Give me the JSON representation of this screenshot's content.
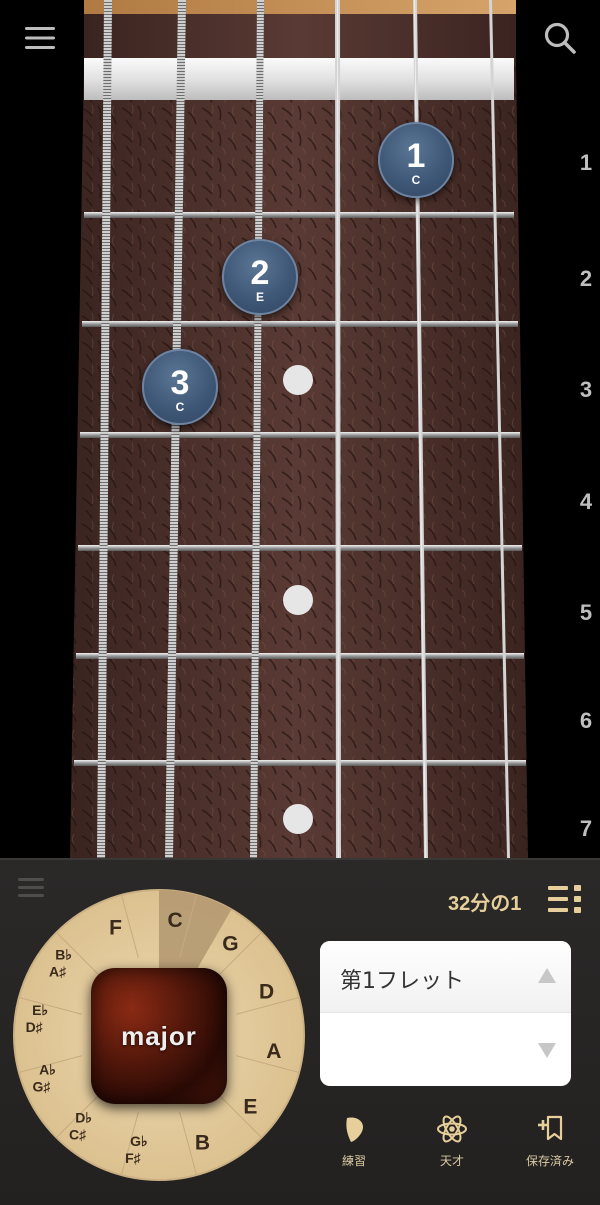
{
  "fretboard": {
    "fret_numbers": [
      "1",
      "2",
      "3",
      "4",
      "5",
      "6",
      "7"
    ],
    "fingers": [
      {
        "number": "1",
        "note": "C"
      },
      {
        "number": "2",
        "note": "E"
      },
      {
        "number": "3",
        "note": "C"
      }
    ]
  },
  "icons": {
    "menu": "hamburger-menu-icon",
    "search": "search-icon",
    "list": "list-settings-icon",
    "practice": "guitar-pick-icon",
    "genius": "atom-icon",
    "saved": "bookmark-add-icon"
  },
  "panel": {
    "tempo_label": "32分の1"
  },
  "circle_of_fifths": {
    "keys": [
      {
        "line1": "C",
        "line2": ""
      },
      {
        "line1": "G",
        "line2": ""
      },
      {
        "line1": "D",
        "line2": ""
      },
      {
        "line1": "A",
        "line2": ""
      },
      {
        "line1": "E",
        "line2": ""
      },
      {
        "line1": "B",
        "line2": ""
      },
      {
        "line1": "G♭",
        "line2": "F♯"
      },
      {
        "line1": "D♭",
        "line2": "C♯"
      },
      {
        "line1": "A♭",
        "line2": "G♯"
      },
      {
        "line1": "E♭",
        "line2": "D♯"
      },
      {
        "line1": "B♭",
        "line2": "A♯"
      },
      {
        "line1": "F",
        "line2": ""
      }
    ],
    "selected": "C",
    "chord_quality": "major"
  },
  "fret_picker": {
    "value": "第1フレット"
  },
  "nav": {
    "practice": "練習",
    "genius": "天才",
    "saved": "保存済み"
  },
  "colors": {
    "finger_marker": "#3f5877",
    "accent_text": "#e6cf9a",
    "panel_bg": "#232120",
    "wheel_wood": "#e4cc9c"
  }
}
